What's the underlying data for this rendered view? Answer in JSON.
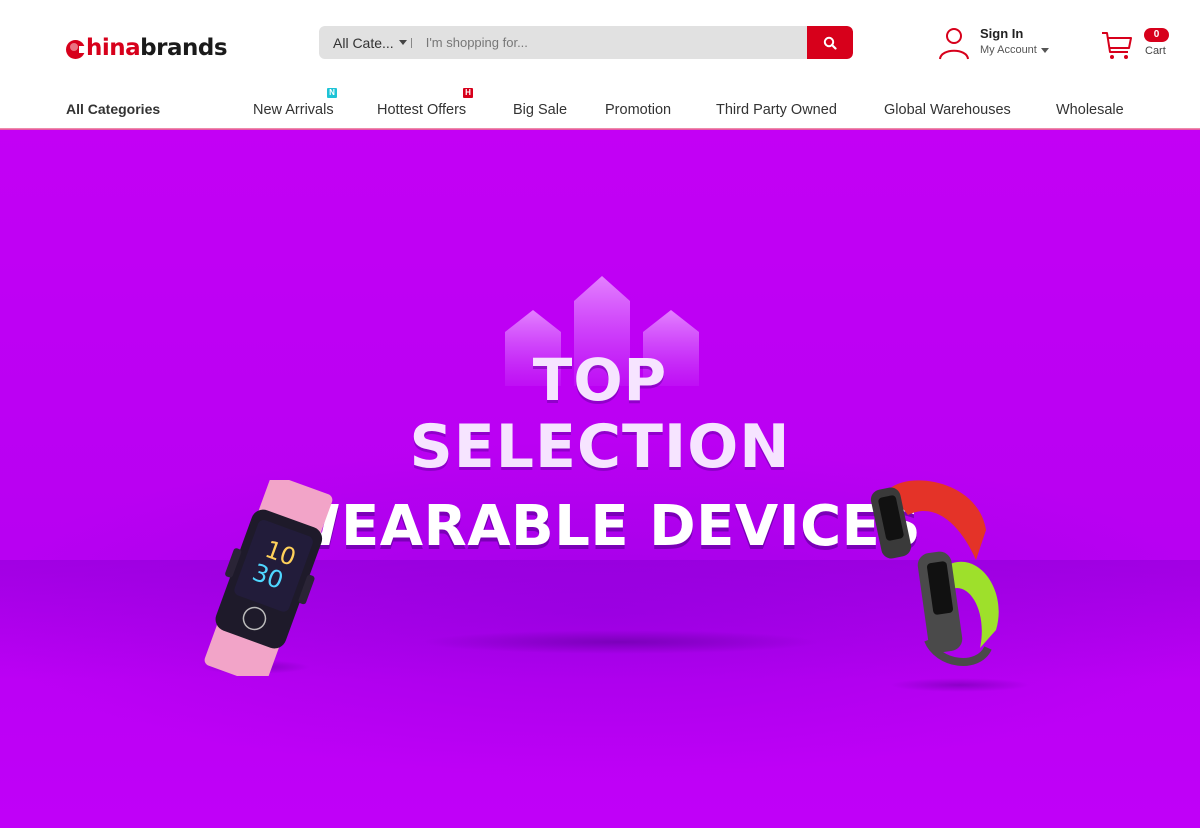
{
  "brand": {
    "logo_prefix": "hina",
    "logo_suffix": "brands",
    "accent_color": "#d7001b"
  },
  "search": {
    "category_label": "All Cate...",
    "placeholder": "I'm shopping for...",
    "value": "",
    "button_icon": "search-icon"
  },
  "account": {
    "sign_in": "Sign In",
    "my_account": "My Account",
    "icon": "user-icon"
  },
  "cart": {
    "count": "0",
    "label": "Cart",
    "icon": "cart-icon"
  },
  "nav": {
    "all_categories": "All Categories",
    "items": [
      {
        "label": "New Arrivals",
        "tag": "N",
        "tag_color": "#1ec3d6"
      },
      {
        "label": "Hottest Offers",
        "tag": "H",
        "tag_color": "#d7001b"
      },
      {
        "label": "Big Sale"
      },
      {
        "label": "Promotion"
      },
      {
        "label": "Third Party Owned"
      },
      {
        "label": "Global Warehouses"
      },
      {
        "label": "Wholesale"
      }
    ]
  },
  "banner": {
    "line1": "TOP",
    "line2": "SELECTION",
    "line3": "WEARABLE DEVICES",
    "background_color": "#c000f5",
    "watch_left_time_hour": "10",
    "watch_left_time_min": "30"
  }
}
